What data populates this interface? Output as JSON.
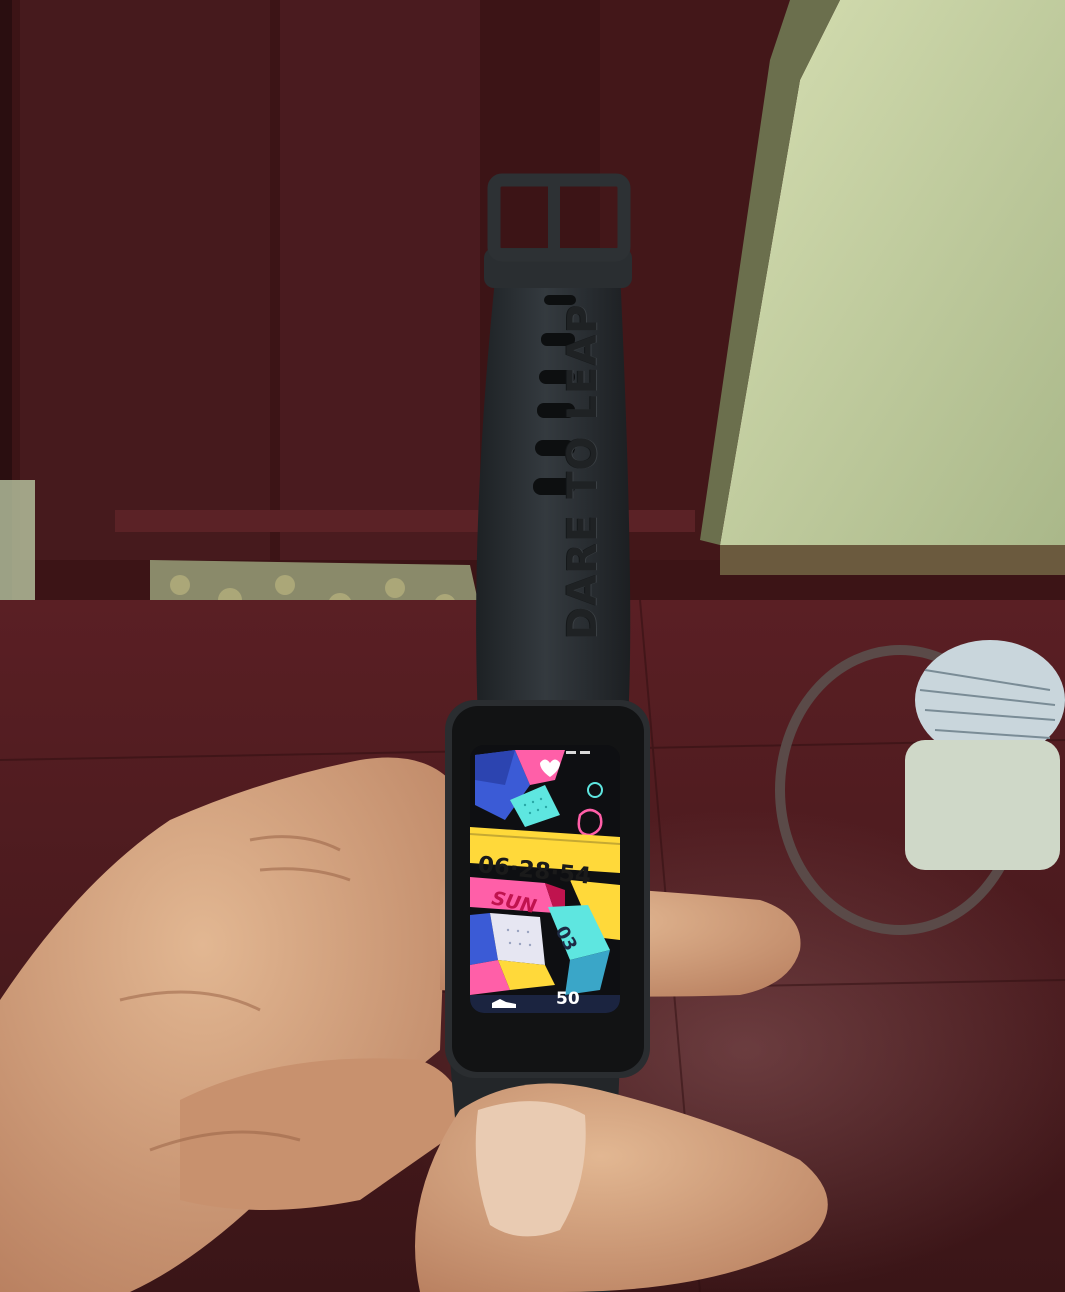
{
  "band": {
    "engraving": "DARE TO LEAP"
  },
  "watch_face": {
    "time": "06·28·54",
    "day": "SUN",
    "date": "03",
    "steps": "50",
    "icons": [
      "heart-icon",
      "footprint-icon",
      "shoe-icon"
    ]
  },
  "colors": {
    "wall": "#3c1414",
    "door_panel": "#4a1a1e",
    "cabinet": "#c8d3a4",
    "floor": "#4a1c1f",
    "strap": "#2b2f33",
    "skin": "#d4a37f",
    "face_pink": "#ff5fa8",
    "face_yellow": "#ffd93a",
    "face_cyan": "#5ee6e0",
    "face_blue": "#3b5bd6"
  }
}
